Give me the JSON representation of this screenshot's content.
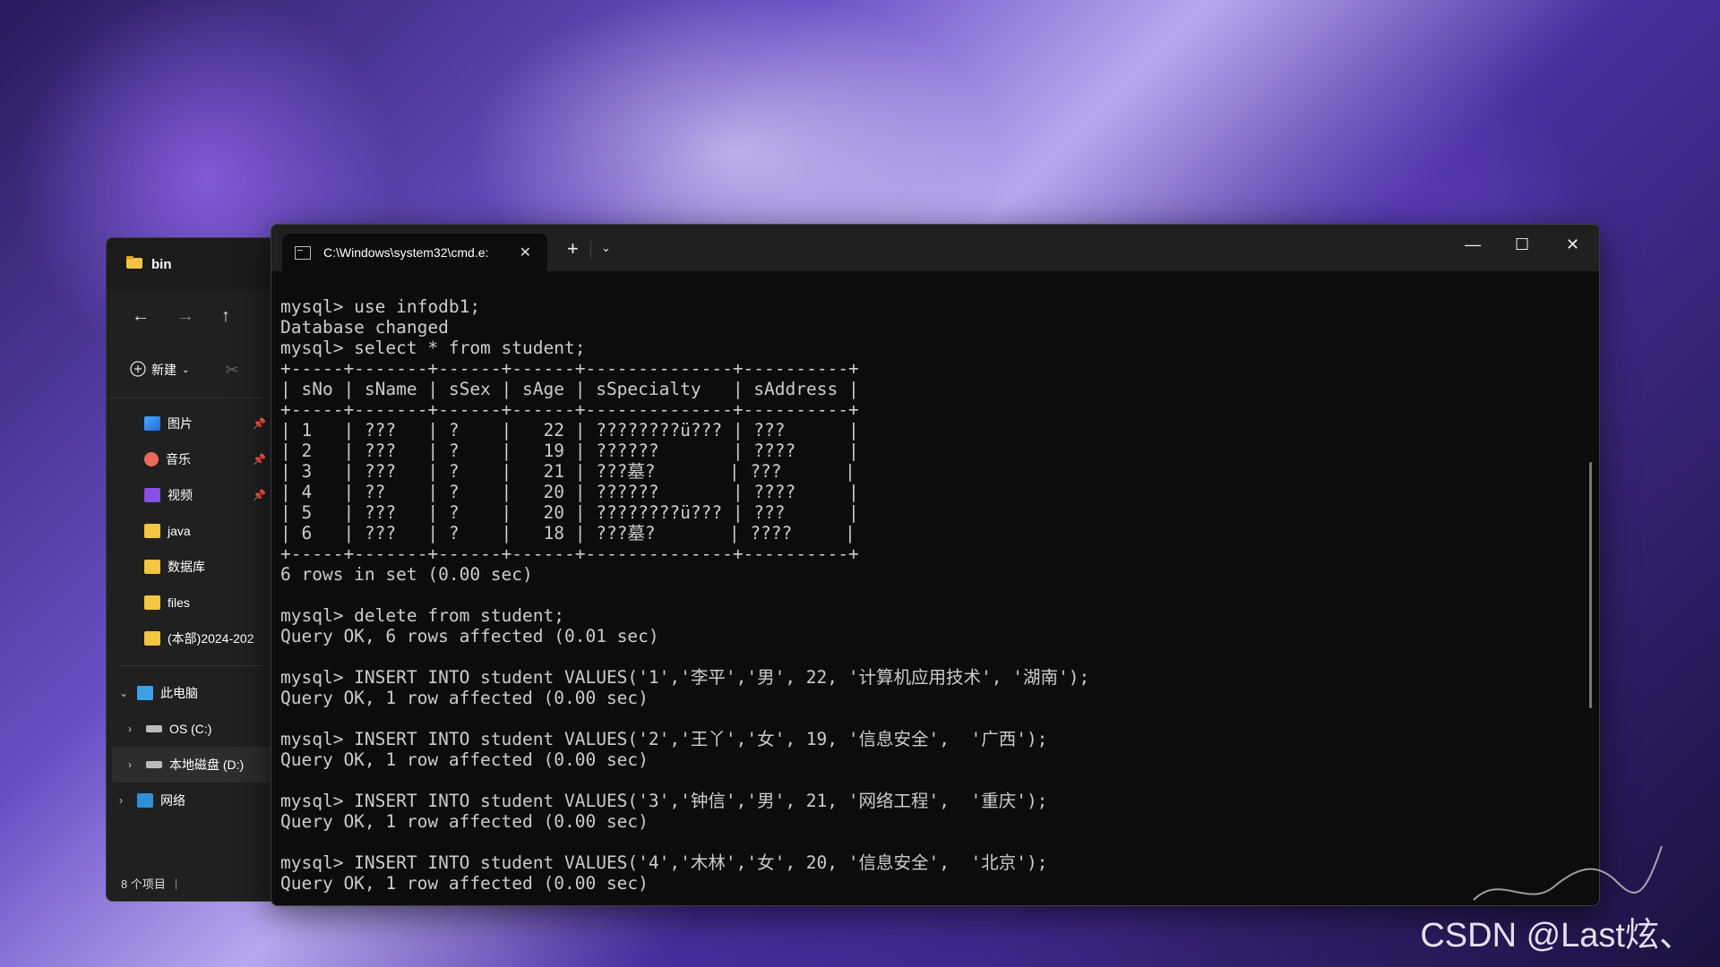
{
  "explorer": {
    "title": "bin",
    "toolbar": {
      "new_label": "新建"
    },
    "quick_access": [
      {
        "label": "图片",
        "icon": "pictures-icon",
        "pinned": true
      },
      {
        "label": "音乐",
        "icon": "music-icon",
        "pinned": true
      },
      {
        "label": "视频",
        "icon": "video-icon",
        "pinned": true
      },
      {
        "label": "java",
        "icon": "folder-icon",
        "pinned": false
      },
      {
        "label": "数据库",
        "icon": "folder-icon",
        "pinned": false
      },
      {
        "label": "files",
        "icon": "folder-icon",
        "pinned": false
      },
      {
        "label": "(本部)2024-202",
        "icon": "folder-icon",
        "pinned": false
      }
    ],
    "tree": [
      {
        "label": "此电脑",
        "icon": "computer-icon",
        "expanded": true
      },
      {
        "label": "OS (C:)",
        "icon": "drive-icon"
      },
      {
        "label": "本地磁盘 (D:)",
        "icon": "drive-icon",
        "selected": true
      },
      {
        "label": "网络",
        "icon": "network-icon"
      }
    ],
    "status": "8 个项目"
  },
  "terminal": {
    "tab_title": "C:\\Windows\\system32\\cmd.e:",
    "lines": [
      "mysql> use infodb1;",
      "Database changed",
      "mysql> select * from student;",
      "+-----+-------+------+------+--------------+----------+",
      "| sNo | sName | sSex | sAge | sSpecialty   | sAddress |",
      "+-----+-------+------+------+--------------+----------+",
      "| 1   | ???   | ?    |   22 | ????????ü??? | ???      |",
      "| 2   | ???   | ?    |   19 | ??????       | ????     |",
      "| 3   | ???   | ?    |   21 | ???墓?       | ???      |",
      "| 4   | ??    | ?    |   20 | ??????       | ????     |",
      "| 5   | ???   | ?    |   20 | ????????ü??? | ???      |",
      "| 6   | ???   | ?    |   18 | ???墓?       | ????     |",
      "+-----+-------+------+------+--------------+----------+",
      "6 rows in set (0.00 sec)",
      "",
      "mysql> delete from student;",
      "Query OK, 6 rows affected (0.01 sec)",
      "",
      "mysql> INSERT INTO student VALUES('1','李平','男', 22, '计算机应用技术', '湖南');",
      "Query OK, 1 row affected (0.00 sec)",
      "",
      "mysql> INSERT INTO student VALUES('2','王丫','女', 19, '信息安全',  '广西');",
      "Query OK, 1 row affected (0.00 sec)",
      "",
      "mysql> INSERT INTO student VALUES('3','钟信','男', 21, '网络工程',  '重庆');",
      "Query OK, 1 row affected (0.00 sec)",
      "",
      "mysql> INSERT INTO student VALUES('4','木林','女', 20, '信息安全',  '北京');",
      "Query OK, 1 row affected (0.00 sec)"
    ]
  },
  "watermark": "CSDN @Last炫、",
  "colors": {
    "terminal_bg": "#0c0c0c",
    "terminal_fg": "#cccccc",
    "explorer_bg": "#202020",
    "folder": "#f4c542"
  }
}
